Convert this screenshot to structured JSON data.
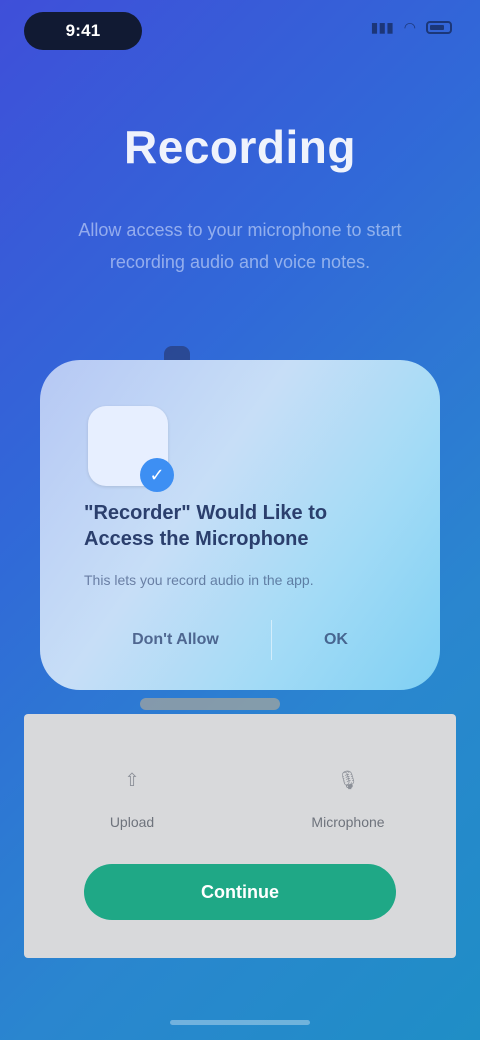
{
  "status_bar": {
    "time": "9:41"
  },
  "header": {
    "title": "Recording",
    "subtitle": "Allow access to your microphone to start recording audio and voice notes."
  },
  "prompt_card": {
    "icon_glyph": "✓",
    "question": "\"Recorder\" Would Like to Access the Microphone",
    "description": "This lets you record audio in the app.",
    "deny_label": "Don't Allow",
    "allow_label": "OK"
  },
  "sheet": {
    "options": [
      {
        "icon": "arrow-up-icon",
        "label": "Upload"
      },
      {
        "icon": "microphone-icon",
        "label": "Microphone"
      }
    ],
    "primary_label": "Continue"
  },
  "colors": {
    "accent": "#1fa886",
    "background_start": "#3f4fd9",
    "background_end": "#1f8ec6"
  }
}
